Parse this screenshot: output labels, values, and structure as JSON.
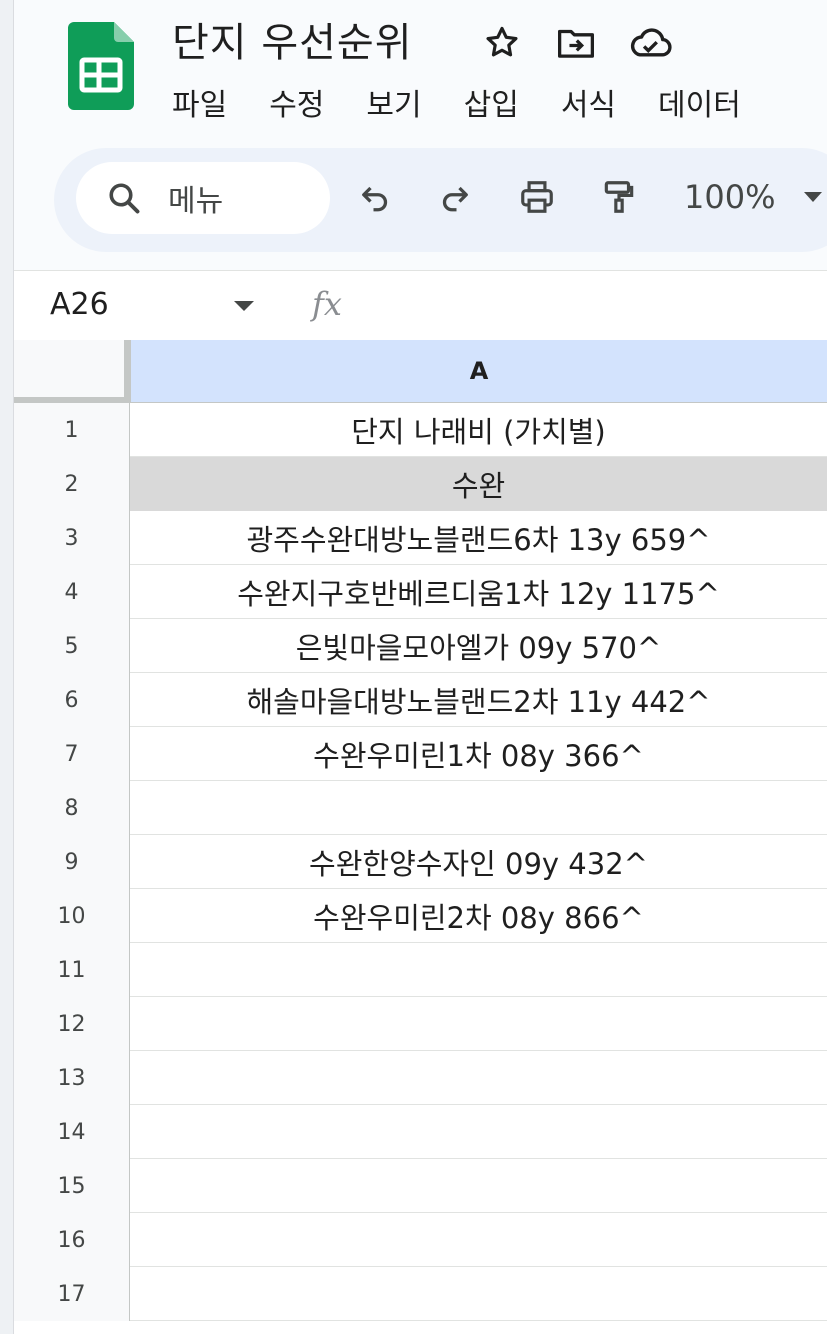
{
  "app": {
    "doc_title": "단지 우선순위",
    "title_icons": [
      "star-icon",
      "move-to-folder-icon",
      "cloud-status-icon"
    ],
    "menu": [
      "파일",
      "수정",
      "보기",
      "삽입",
      "서식",
      "데이터"
    ]
  },
  "toolbar": {
    "search_label": "메뉴",
    "buttons": [
      "undo-icon",
      "redo-icon",
      "print-icon",
      "paint-format-icon"
    ],
    "zoom": "100%"
  },
  "formula_bar": {
    "name_box": "A26",
    "fx_label": "fx",
    "value": ""
  },
  "grid": {
    "column_header": "A",
    "rows": [
      {
        "num": "1",
        "value": "단지 나래비 (가치별)",
        "fill": ""
      },
      {
        "num": "2",
        "value": "수완",
        "fill": "#d9d9d9"
      },
      {
        "num": "3",
        "value": "광주수완대방노블랜드6차 13y 659^",
        "fill": ""
      },
      {
        "num": "4",
        "value": "수완지구호반베르디움1차 12y 1175^",
        "fill": ""
      },
      {
        "num": "5",
        "value": "은빛마을모아엘가 09y 570^",
        "fill": ""
      },
      {
        "num": "6",
        "value": "해솔마을대방노블랜드2차 11y 442^",
        "fill": ""
      },
      {
        "num": "7",
        "value": "수완우미린1차 08y 366^",
        "fill": ""
      },
      {
        "num": "8",
        "value": "",
        "fill": ""
      },
      {
        "num": "9",
        "value": "수완한양수자인 09y 432^",
        "fill": ""
      },
      {
        "num": "10",
        "value": "수완우미린2차 08y 866^",
        "fill": ""
      },
      {
        "num": "11",
        "value": "",
        "fill": ""
      },
      {
        "num": "12",
        "value": "",
        "fill": ""
      },
      {
        "num": "13",
        "value": "",
        "fill": ""
      },
      {
        "num": "14",
        "value": "",
        "fill": ""
      },
      {
        "num": "15",
        "value": "",
        "fill": ""
      },
      {
        "num": "16",
        "value": "",
        "fill": ""
      },
      {
        "num": "17",
        "value": "",
        "fill": ""
      }
    ]
  },
  "colors": {
    "brand_green": "#0f9d58",
    "column_header_selected": "#d3e3fd",
    "row2_fill": "#d9d9d9"
  }
}
